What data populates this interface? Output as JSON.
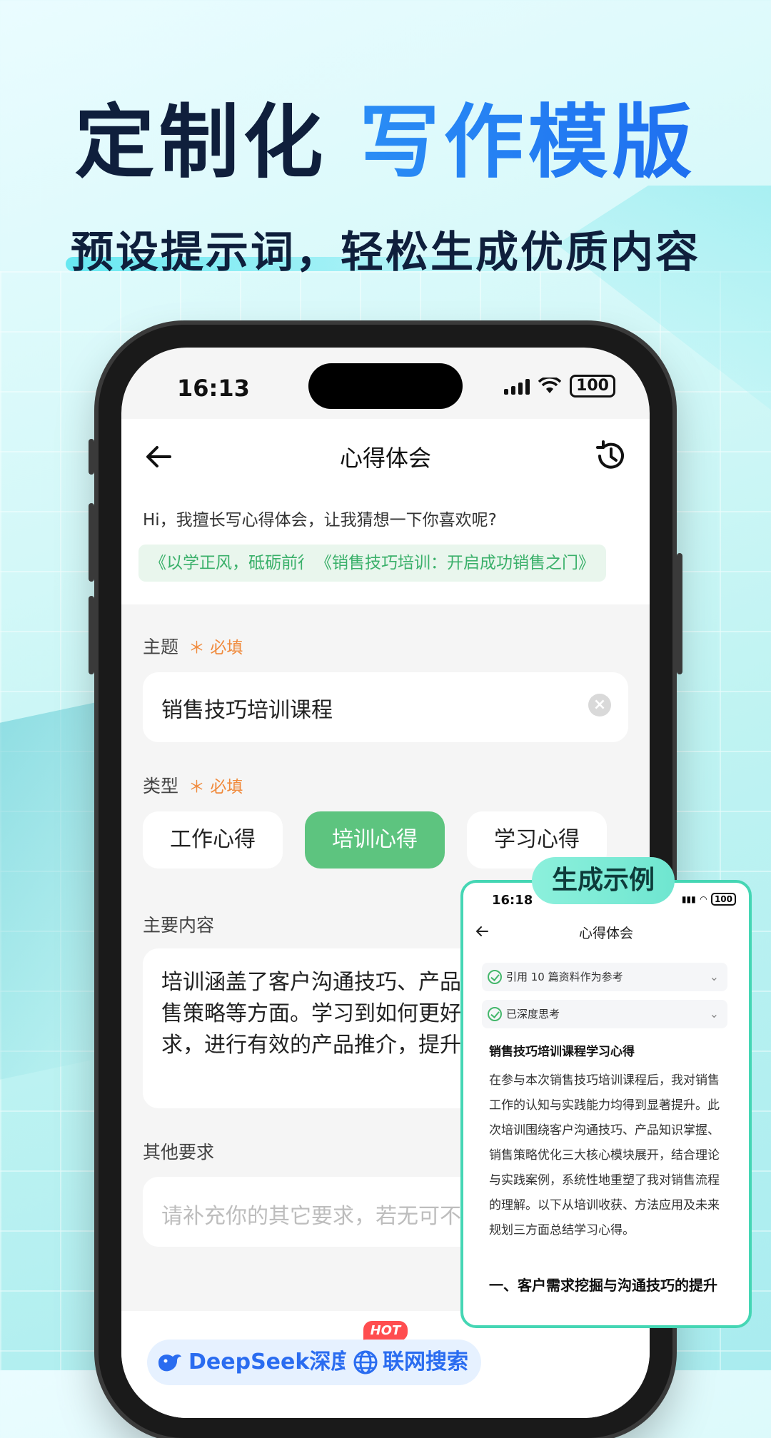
{
  "hero": {
    "title_dark": "定制化",
    "title_blue": "写作模版",
    "subtitle": "预设提示词，轻松生成优质内容"
  },
  "status_bar": {
    "time": "16:13",
    "battery": "100"
  },
  "nav": {
    "title": "心得体会"
  },
  "intro": {
    "text": "Hi，我擅长写心得体会，让我猜想一下你喜欢呢?",
    "chips": [
      "《以学正风，砥砺前行》",
      "《销售技巧培训：开启成功销售之门》"
    ]
  },
  "form": {
    "required_label": "＊ 必填",
    "topic": {
      "label": "主题",
      "value": "销售技巧培训课程"
    },
    "type": {
      "label": "类型",
      "options": [
        "工作心得",
        "培训心得",
        "学习心得"
      ],
      "selected": "培训心得"
    },
    "content": {
      "label": "主要内容",
      "value": "培训涵盖了客户沟通技巧、产品知识掌握以及销售策略等方面。学习到如何更好地挖掘客户需求，进行有效的产品推介，提升销售业绩。"
    },
    "other": {
      "label": "其他要求",
      "placeholder": "请补充你的其它要求，若无可不填"
    }
  },
  "bottom": {
    "deepseek_label": "DeepSeek深度思考",
    "hot_badge": "HOT",
    "web_search_label": "联网搜索"
  },
  "example": {
    "tag": "生成示例",
    "time": "16:18",
    "battery": "100",
    "nav_title": "心得体会",
    "rows": [
      "引用 10 篇资料作为参考",
      "已深度思考"
    ],
    "doc_title": "销售技巧培训课程学习心得",
    "doc_body": "在参与本次销售技巧培训课程后，我对销售工作的认知与实践能力均得到显著提升。此次培训围绕客户沟通技巧、产品知识掌握、销售策略优化三大核心模块展开，结合理论与实践案例，系统性地重塑了我对销售流程的理解。以下从培训收获、方法应用及未来规划三方面总结学习心得。",
    "section_heading": "一、客户需求挖掘与沟通技巧的提升"
  },
  "colors": {
    "accent_green": "#5dc47f",
    "chip_green": "#3ab06a",
    "required_orange": "#f08a3c",
    "title_blue": "#1e6ff0",
    "title_dark": "#0f1f3c"
  }
}
